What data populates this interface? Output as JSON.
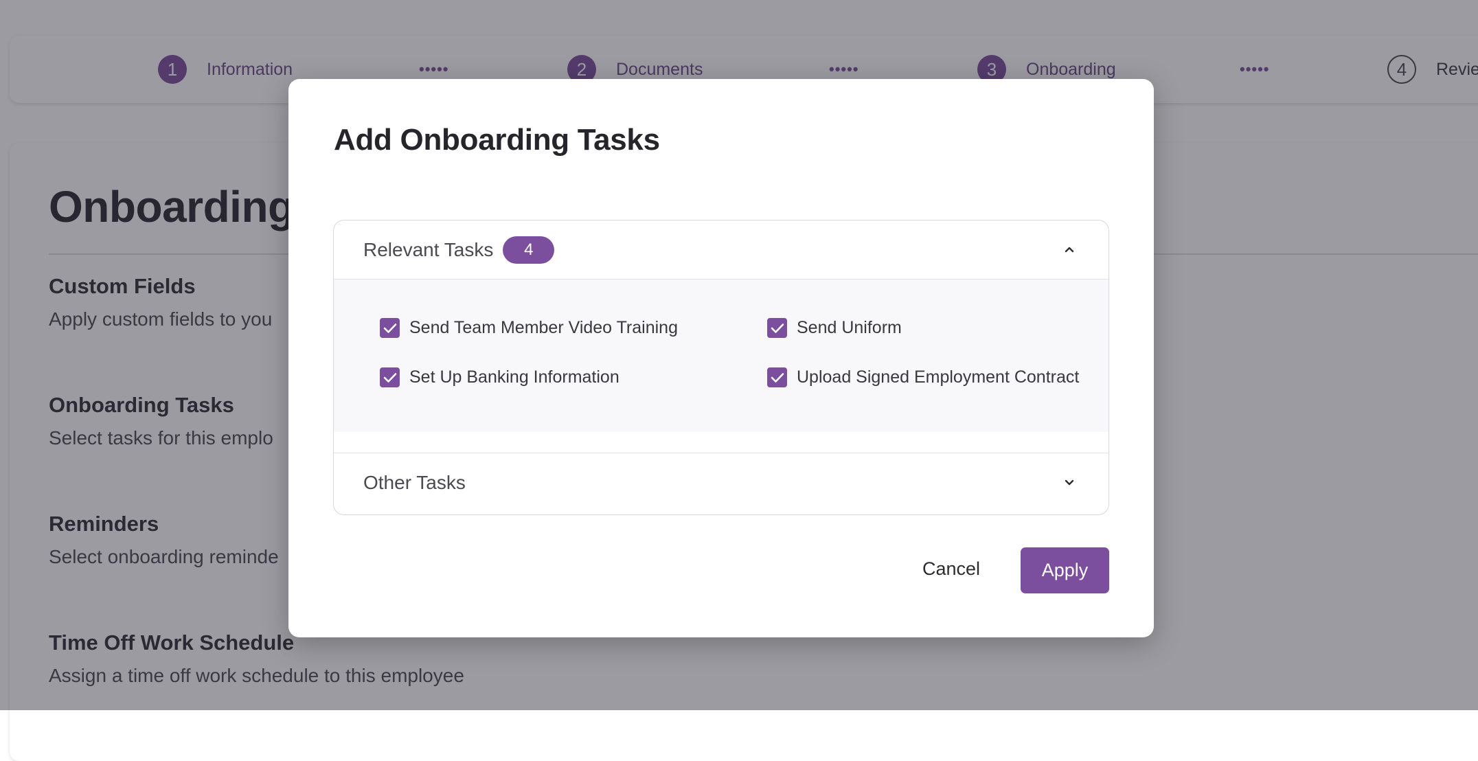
{
  "stepper": {
    "steps": [
      {
        "number": "1",
        "label": "Information"
      },
      {
        "number": "2",
        "label": "Documents"
      },
      {
        "number": "3",
        "label": "Onboarding"
      },
      {
        "number": "4",
        "label": "Revie"
      }
    ],
    "separator": "•••••"
  },
  "page": {
    "title": "Onboarding",
    "sections": [
      {
        "heading": "Custom Fields",
        "description": "Apply custom fields to you"
      },
      {
        "heading": "Onboarding Tasks",
        "description": "Select tasks for this emplo"
      },
      {
        "heading": "Reminders",
        "description": "Select onboarding reminde"
      },
      {
        "heading": "Time Off Work Schedule",
        "description": "Assign a time off work schedule to this employee"
      }
    ]
  },
  "modal": {
    "title": "Add Onboarding Tasks",
    "relevant": {
      "title": "Relevant Tasks",
      "count": "4",
      "expanded": true,
      "tasks": [
        {
          "label": "Send Team Member Video Training",
          "checked": true
        },
        {
          "label": "Send Uniform",
          "checked": true
        },
        {
          "label": "Set Up Banking Information",
          "checked": true
        },
        {
          "label": "Upload Signed Employment Contract",
          "checked": true
        }
      ]
    },
    "other": {
      "title": "Other Tasks",
      "expanded": false
    },
    "cancel_label": "Cancel",
    "apply_label": "Apply"
  },
  "colors": {
    "accent": "#7b4f9d",
    "overlay": "rgba(40,38,50,0.46)"
  },
  "icons": {
    "relevant_toggle": "chevron-up-icon",
    "other_toggle": "chevron-down-icon",
    "checkbox_mark": "check-icon"
  }
}
